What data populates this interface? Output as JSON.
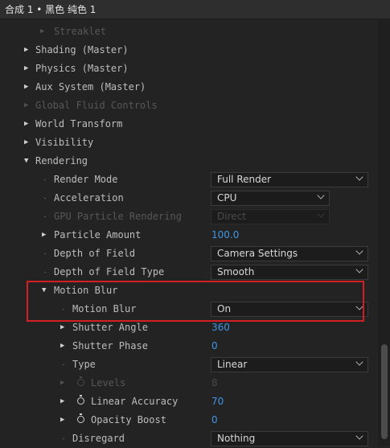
{
  "title": "合成 1 • 黑色 纯色 1",
  "rows": {
    "streaklet": {
      "label": "Streaklet"
    },
    "shading": {
      "label": "Shading (Master)"
    },
    "physics": {
      "label": "Physics (Master)"
    },
    "aux_system": {
      "label": "Aux System (Master)"
    },
    "global_fluid": {
      "label": "Global Fluid Controls"
    },
    "world_transform": {
      "label": "World Transform"
    },
    "visibility": {
      "label": "Visibility"
    },
    "rendering": {
      "label": "Rendering"
    },
    "render_mode": {
      "label": "Render Mode",
      "value": "Full Render"
    },
    "acceleration": {
      "label": "Acceleration",
      "value": "CPU"
    },
    "gpu_particle": {
      "label": "GPU Particle Rendering",
      "value": "Direct"
    },
    "particle_amount": {
      "label": "Particle Amount",
      "value": "100.0"
    },
    "depth_of_field": {
      "label": "Depth of Field",
      "value": "Camera Settings"
    },
    "dof_type": {
      "label": "Depth of Field Type",
      "value": "Smooth"
    },
    "motion_blur_group": {
      "label": "Motion Blur"
    },
    "motion_blur": {
      "label": "Motion Blur",
      "value": "On"
    },
    "shutter_angle": {
      "label": "Shutter Angle",
      "value": "360"
    },
    "shutter_phase": {
      "label": "Shutter Phase",
      "value": "0"
    },
    "type": {
      "label": "Type",
      "value": "Linear"
    },
    "levels": {
      "label": "Levels",
      "value": "8"
    },
    "linear_accuracy": {
      "label": "Linear Accuracy",
      "value": "70"
    },
    "opacity_boost": {
      "label": "Opacity Boost",
      "value": "0"
    },
    "disregard": {
      "label": "Disregard",
      "value": "Nothing"
    }
  },
  "glyphs": {
    "collapsed": "▶",
    "expanded": "▼"
  },
  "colors": {
    "value_blue": "#3f95e3",
    "highlight_red": "#d21f26",
    "panel_bg": "#232323"
  }
}
